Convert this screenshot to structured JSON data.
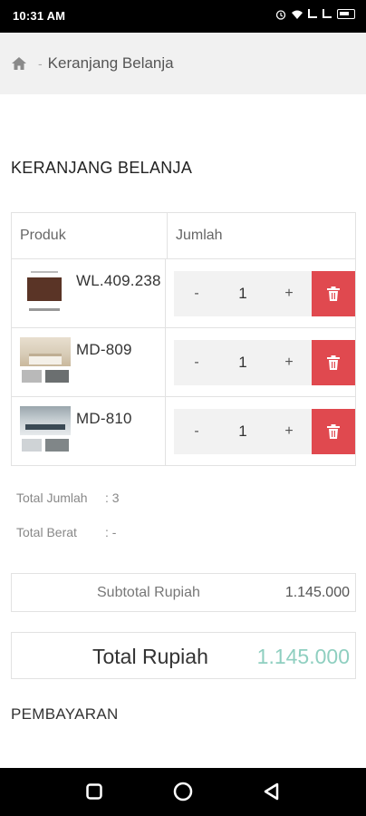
{
  "status_bar": {
    "time": "10:31 AM",
    "icons": [
      "alarm-icon",
      "wifi-icon",
      "signal-icon",
      "signal-icon",
      "battery-icon"
    ]
  },
  "breadcrumb": {
    "home_icon": "home-icon",
    "separator": "-",
    "current": "Keranjang Belanja"
  },
  "page_title": "KERANJANG BELANJA",
  "table": {
    "headers": {
      "product": "Produk",
      "qty": "Jumlah"
    },
    "items": [
      {
        "name": "WL.409.238",
        "qty": "1",
        "minus": "-",
        "plus": "+"
      },
      {
        "name": "MD-809",
        "qty": "1",
        "minus": "-",
        "plus": "+"
      },
      {
        "name": "MD-810",
        "qty": "1",
        "minus": "-",
        "plus": "+"
      }
    ],
    "delete_color": "#e0494f"
  },
  "summary": {
    "total_qty_label": "Total Jumlah",
    "total_qty_value": ": 3",
    "total_weight_label": "Total Berat",
    "total_weight_value": ": -"
  },
  "subtotal": {
    "label": "Subtotal Rupiah",
    "value": "1.145.000"
  },
  "total": {
    "label": "Total Rupiah",
    "value": "1.145.000",
    "value_color": "#8fcfc0"
  },
  "payment_section": "PEMBAYARAN",
  "nav_bar": {
    "icons": [
      "recent-apps-icon",
      "home-circle-icon",
      "back-icon"
    ]
  }
}
